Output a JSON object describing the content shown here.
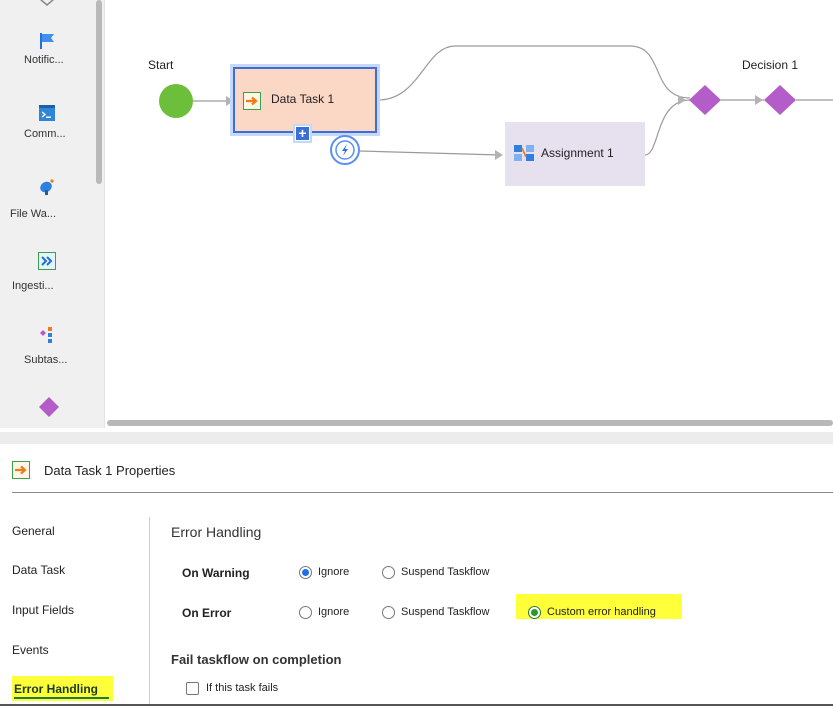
{
  "palette": {
    "items": [
      {
        "label": "Notific...",
        "icon": "flag-icon"
      },
      {
        "label": "Comm...",
        "icon": "terminal-icon"
      },
      {
        "label": "File Wa...",
        "icon": "satellite-dish-icon"
      },
      {
        "label": "Ingesti...",
        "icon": "double-arrow-icon"
      },
      {
        "label": "Subtas...",
        "icon": "subtask-icon"
      }
    ]
  },
  "flow": {
    "start_label": "Start",
    "data_task_label": "Data Task 1",
    "assignment_label": "Assignment 1",
    "decision_label": "Decision 1",
    "colors": {
      "start": "#6bbf3a",
      "data_task_fill": "#fbd7c6",
      "selection": "#3d6fd6",
      "assignment_fill": "#e6e0ef",
      "diamond": "#b45cc8"
    }
  },
  "properties": {
    "title": "Data Task 1 Properties",
    "nav": [
      {
        "label": "General"
      },
      {
        "label": "Data Task"
      },
      {
        "label": "Input Fields"
      },
      {
        "label": "Events"
      },
      {
        "label": "Error Handling",
        "active": true
      }
    ],
    "section_title": "Error Handling",
    "on_warning": {
      "label": "On Warning",
      "options": [
        "Ignore",
        "Suspend Taskflow"
      ],
      "selected": "Ignore"
    },
    "on_error": {
      "label": "On Error",
      "options": [
        "Ignore",
        "Suspend Taskflow",
        "Custom error handling"
      ],
      "selected": "Custom error handling"
    },
    "fail_title": "Fail taskflow on completion",
    "fail_checkbox_label": "If this task fails",
    "fail_checked": false,
    "highlight_color": "#ffff3a"
  }
}
